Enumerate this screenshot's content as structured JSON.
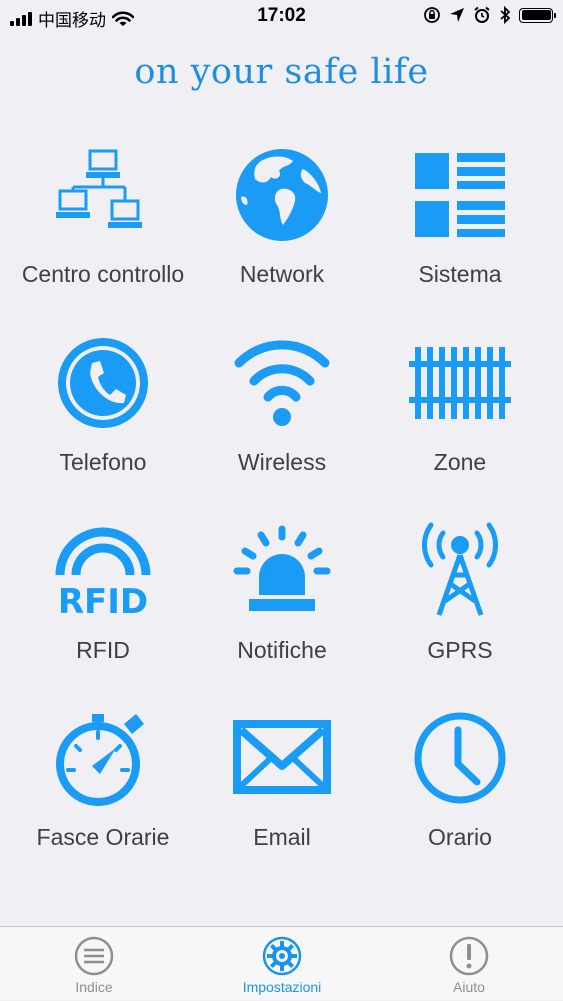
{
  "status_bar": {
    "carrier": "中国移动",
    "time": "17:02"
  },
  "header": {
    "tagline": "on your safe life"
  },
  "colors": {
    "accent": "#1A9BF5",
    "tab_active": "#1A93F0",
    "tab_inactive": "#8E8E93",
    "background": "#EFEFF4"
  },
  "menu": {
    "items": [
      {
        "label": "Centro controllo",
        "icon": "network-computers-icon"
      },
      {
        "label": "Network",
        "icon": "globe-icon"
      },
      {
        "label": "Sistema",
        "icon": "grid-list-icon"
      },
      {
        "label": "Telefono",
        "icon": "phone-icon"
      },
      {
        "label": "Wireless",
        "icon": "wifi-icon"
      },
      {
        "label": "Zone",
        "icon": "fence-icon"
      },
      {
        "label": "RFID",
        "icon": "rfid-icon"
      },
      {
        "label": "Notifiche",
        "icon": "siren-icon"
      },
      {
        "label": "GPRS",
        "icon": "antenna-icon"
      },
      {
        "label": "Fasce Orarie",
        "icon": "stopwatch-icon"
      },
      {
        "label": "Email",
        "icon": "envelope-icon"
      },
      {
        "label": "Orario",
        "icon": "clock-icon"
      }
    ]
  },
  "tab_bar": {
    "tabs": [
      {
        "label": "Indice",
        "icon": "menu-lines-icon",
        "active": false
      },
      {
        "label": "Impostazioni",
        "icon": "gear-icon",
        "active": true
      },
      {
        "label": "Aiuto",
        "icon": "exclamation-icon",
        "active": false
      }
    ]
  }
}
